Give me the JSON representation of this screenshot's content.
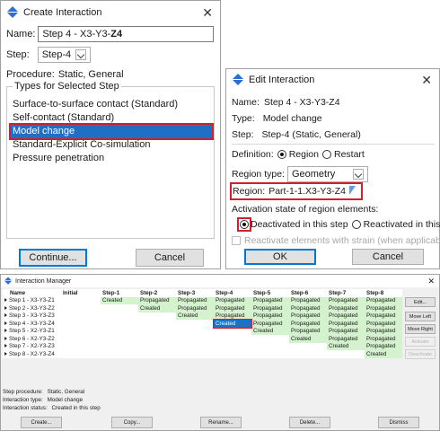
{
  "create_interaction": {
    "title": "Create Interaction",
    "name_label": "Name:",
    "name_value_prefix": "Step 4 - X3-Y3-",
    "name_value_bold": "Z4",
    "step_label": "Step:",
    "step_value": "Step-4",
    "procedure_label": "Procedure:",
    "procedure_value": "Static, General",
    "group_label": "Types for Selected Step",
    "types": [
      "Surface-to-surface contact (Standard)",
      "Self-contact (Standard)",
      "Model change",
      "Standard-Explicit Co-simulation",
      "Pressure penetration"
    ],
    "selected_type": "Model change",
    "continue_label": "Continue...",
    "cancel_label": "Cancel"
  },
  "edit_interaction": {
    "title": "Edit Interaction",
    "name_label": "Name:",
    "name_value": "Step 4 - X3-Y3-Z4",
    "type_label": "Type:",
    "type_value": "Model change",
    "step_label": "Step:",
    "step_value": "Step-4 (Static, General)",
    "definition_label": "Definition:",
    "definition_option_region": "Region",
    "definition_option_restart": "Restart",
    "definition_selected": "Region",
    "region_type_label": "Region type:",
    "region_type_value": "Geometry",
    "region_label": "Region:",
    "region_value": "Part-1-1.X3-Y3-Z4",
    "activation_label": "Activation state of region elements:",
    "deactivated_label": "Deactivated in this step",
    "reactivated_label": "Reactivated in this step",
    "activation_selected": "Deactivated in this step",
    "reactivate_strain_label": "Reactivate elements with strain (when applicable)",
    "ok_label": "OK",
    "cancel_label": "Cancel"
  },
  "manager": {
    "title": "Interaction Manager",
    "columns": [
      "Name",
      "Initial",
      "Step-1",
      "Step-2",
      "Step-3",
      "Step-4",
      "Step-5",
      "Step-6",
      "Step-7",
      "Step-8"
    ],
    "rows": [
      {
        "name": "Step 1 - X3-Y3-Z1",
        "cells": [
          "",
          "Created",
          "Propagated",
          "Propagated",
          "Propagated",
          "Propagated",
          "Propagated",
          "Propagated",
          "Propagated"
        ]
      },
      {
        "name": "Step 2 - X3-Y3-Z2",
        "cells": [
          "",
          "",
          "Created",
          "Propagated",
          "Propagated",
          "Propagated",
          "Propagated",
          "Propagated",
          "Propagated"
        ]
      },
      {
        "name": "Step 3 - X3-Y3-Z3",
        "cells": [
          "",
          "",
          "",
          "Created",
          "Propagated",
          "Propagated",
          "Propagated",
          "Propagated",
          "Propagated"
        ]
      },
      {
        "name": "Step 4 - X3-Y3-Z4",
        "cells": [
          "",
          "",
          "",
          "",
          "Created",
          "Propagated",
          "Propagated",
          "Propagated",
          "Propagated"
        ]
      },
      {
        "name": "Step 5 - X2-Y3-Z1",
        "cells": [
          "",
          "",
          "",
          "",
          "",
          "Created",
          "Propagated",
          "Propagated",
          "Propagated"
        ]
      },
      {
        "name": "Step 6 - X2-Y3-Z2",
        "cells": [
          "",
          "",
          "",
          "",
          "",
          "",
          "Created",
          "Propagated",
          "Propagated"
        ]
      },
      {
        "name": "Step 7 - X2-Y3-Z3",
        "cells": [
          "",
          "",
          "",
          "",
          "",
          "",
          "",
          "Created",
          "Propagated"
        ]
      },
      {
        "name": "Step 8 - X2-Y3-Z4",
        "cells": [
          "",
          "",
          "",
          "",
          "",
          "",
          "",
          "",
          "Created"
        ]
      }
    ],
    "side_buttons": [
      "Edit...",
      "Move Left",
      "Move Right",
      "Activate",
      "Deactivate"
    ],
    "step_procedure_label": "Step procedure:",
    "step_procedure_value": "Static, General",
    "interaction_type_label": "Interaction type:",
    "interaction_type_value": "Model change",
    "interaction_status_label": "Interaction status:",
    "interaction_status_value": "Created in this step",
    "bottom_buttons": [
      "Create...",
      "Copy...",
      "Rename...",
      "Delete...",
      "Dismiss"
    ]
  },
  "colors": {
    "selection_blue": "#1f6fc5",
    "highlight_red": "#d11f2c",
    "status_green": "#d5f2cf"
  }
}
